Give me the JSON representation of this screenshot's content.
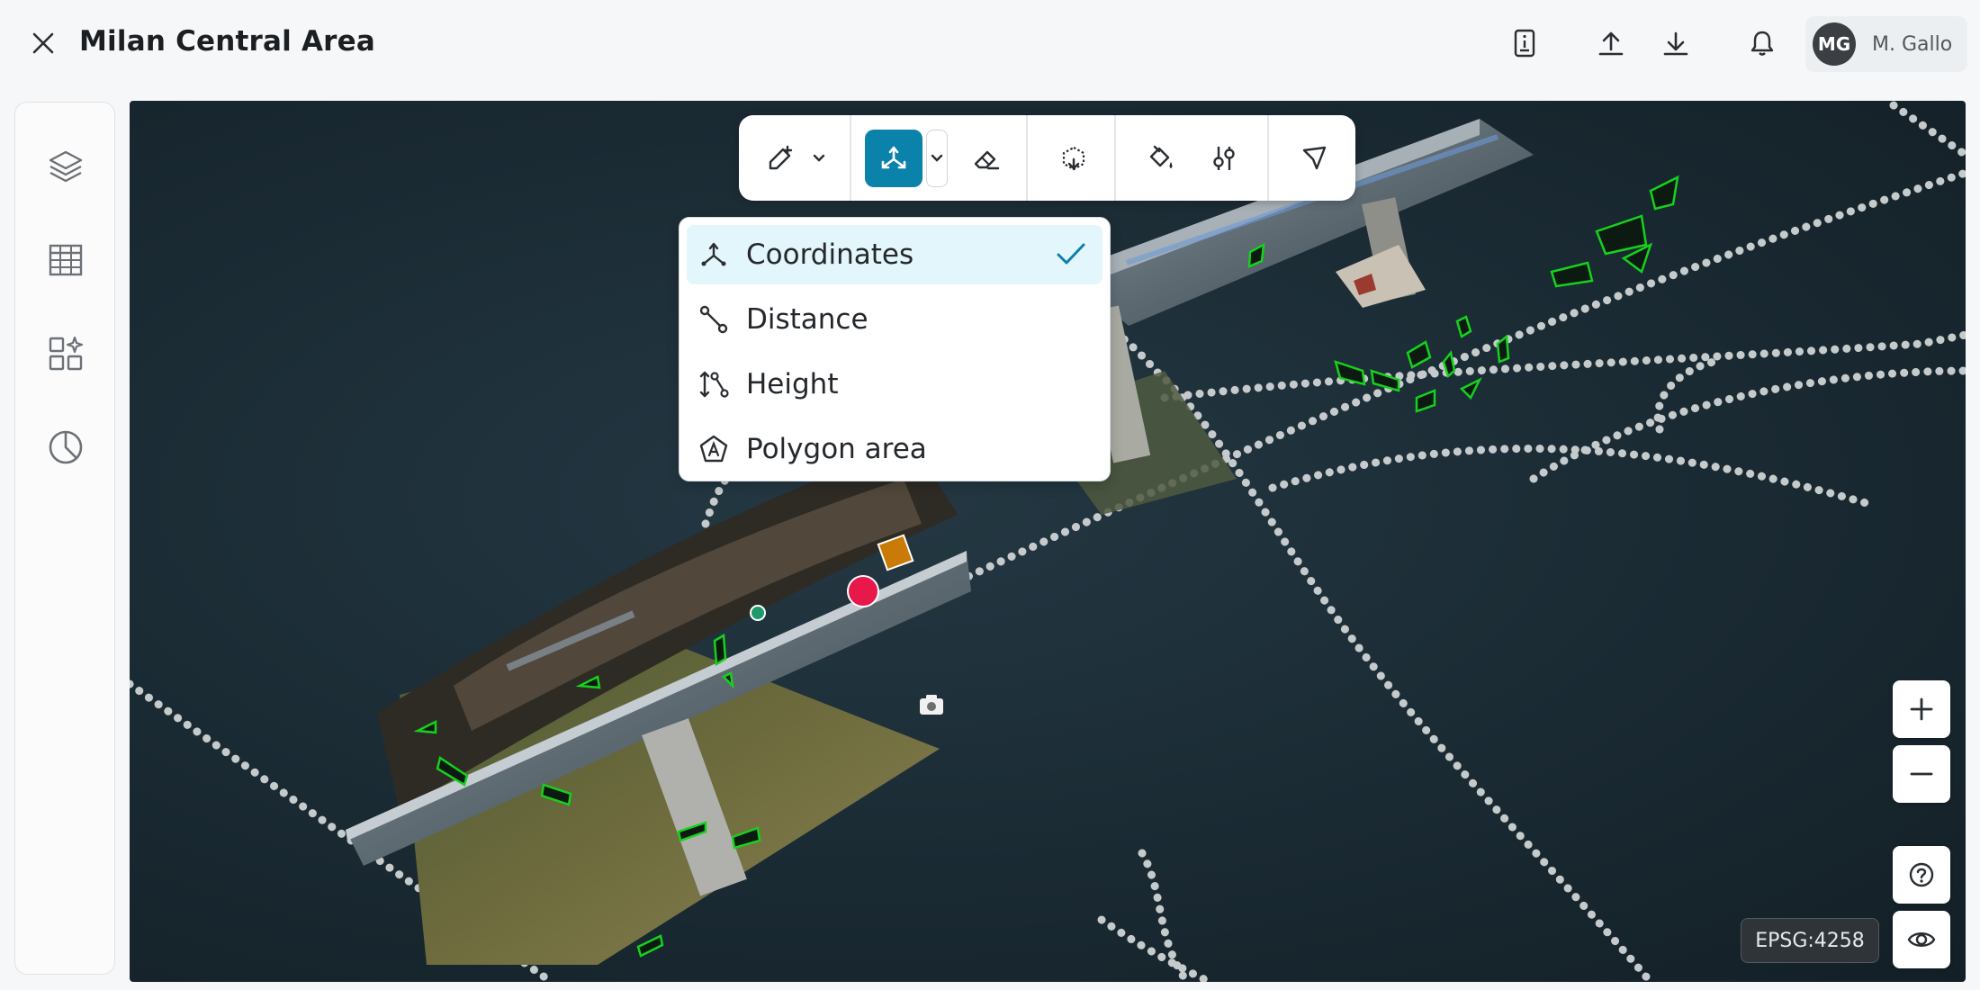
{
  "header": {
    "title": "Milan Central Area",
    "user": {
      "initials": "MG",
      "name": "M. Gallo"
    },
    "icons": [
      "close-icon",
      "report-icon",
      "upload-icon",
      "download-icon",
      "bell-icon"
    ]
  },
  "sidebar": {
    "items": [
      {
        "name": "layers",
        "icon": "layers-icon"
      },
      {
        "name": "table",
        "icon": "table-icon"
      },
      {
        "name": "widgets",
        "icon": "widgets-icon"
      },
      {
        "name": "analytics",
        "icon": "pie-chart-icon"
      }
    ]
  },
  "toolbar": {
    "tools": [
      {
        "name": "draw",
        "icon": "draw-add-icon"
      },
      {
        "name": "measure",
        "icon": "coordinates-icon",
        "active": true
      },
      {
        "name": "erase",
        "icon": "eraser-icon"
      },
      {
        "name": "volume",
        "icon": "volume-icon"
      },
      {
        "name": "paint",
        "icon": "paint-bucket-icon"
      },
      {
        "name": "adjust",
        "icon": "sliders-icon"
      },
      {
        "name": "select",
        "icon": "pointer-icon"
      }
    ]
  },
  "measure_menu": {
    "selected": "Coordinates",
    "items": [
      {
        "label": "Coordinates",
        "icon": "coordinates-icon"
      },
      {
        "label": "Distance",
        "icon": "distance-icon"
      },
      {
        "label": "Height",
        "icon": "height-icon"
      },
      {
        "label": "Polygon area",
        "icon": "polygon-area-icon"
      }
    ]
  },
  "viewport": {
    "crs": "EPSG:4258",
    "controls": [
      "zoom-in-icon",
      "zoom-out-icon",
      "help-icon",
      "eye-icon"
    ]
  },
  "colors": {
    "accent": "#0b82aa",
    "selected_bg": "#e3f6fb",
    "marker_red": "#e8184a",
    "marker_orange": "#c97a07",
    "marker_green": "#1e9a6a",
    "breakline_green": "#16d11c"
  }
}
